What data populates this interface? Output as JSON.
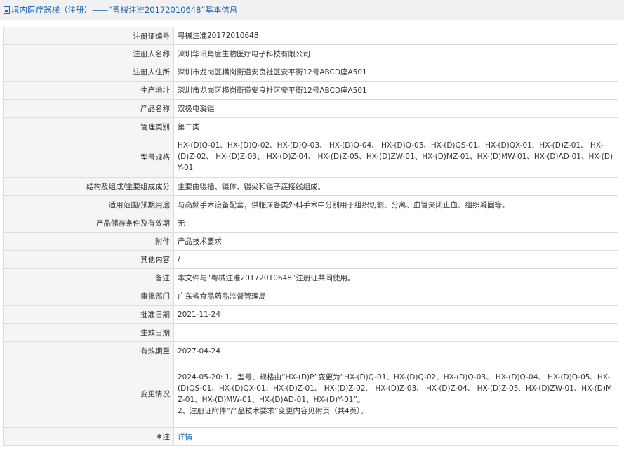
{
  "header": {
    "title": "境内医疗器械（注册）——“粤械注准20172010648”基本信息"
  },
  "rows": [
    {
      "label": "注册证编号",
      "value": "粤械注准20172010648"
    },
    {
      "label": "注册人名称",
      "value": "深圳华讯角度生物医疗电子科技有限公司"
    },
    {
      "label": "注册人住所",
      "value": "深圳市龙岗区横岗街道安良社区安平街12号ABCD座A501"
    },
    {
      "label": "生产地址",
      "value": "深圳市龙岗区横岗街道安良社区安平街12号ABCD座A501"
    },
    {
      "label": "产品名称",
      "value": "双极电凝镊"
    },
    {
      "label": "管理类别",
      "value": "第二类"
    },
    {
      "label": "型号规格",
      "value": "HX-(D)Q-01、HX-(D)Q-02、HX-(D)Q-03、 HX-(D)Q-04、 HX-(D)Q-05、HX-(D)QS-01、HX-(D)QX-01、HX-(D)Z-01、 HX-(D)Z-02、 HX-(D)Z-03、 HX-(D)Z-04、 HX-(D)Z-05、HX-(D)ZW-01、HX-(D)MZ-01、HX-(D)MW-01、HX-(D)AD-01、HX-(D)Y-01"
    },
    {
      "label": "结构及组成/主要组成成分",
      "value": "主要由镊插、镊体、镊尖和镊子连接线组成。"
    },
    {
      "label": "适用范围/预期用途",
      "value": "与高频手术设备配套，供临床各类外科手术中分别用于组织切割、分离、血管夹闭止血、组织凝固等。"
    },
    {
      "label": "产品储存条件及有效期",
      "value": "无"
    },
    {
      "label": "附件",
      "value": "产品技术要求"
    },
    {
      "label": "其他内容",
      "value": "/"
    },
    {
      "label": "备注",
      "value": "本文件与“粤械注准20172010648”注册证共同使用。"
    },
    {
      "label": "审批部门",
      "value": "广东省食品药品监督管理局"
    },
    {
      "label": "批准日期",
      "value": "2021-11-24"
    },
    {
      "label": "生效日期",
      "value": ""
    },
    {
      "label": "有效期至",
      "value": "2027-04-24"
    }
  ],
  "change": {
    "label": "变更情况",
    "line1": "2024-05-20: 1、型号、规格由“HX-(D)P”变更为“HX-(D)Q-01、HX-(D)Q-02、HX-(D)Q-03、 HX-(D)Q-04、 HX-(D)Q-05、HX-(D)QS-01、HX-(D)QX-01、HX-(D)Z-01、 HX-(D)Z-02、 HX-(D)Z-03、 HX-(D)Z-04、 HX-(D)Z-05、HX-(D)ZW-01、HX-(D)MZ-01、HX-(D)MW-01、HX-(D)AD-01、HX-(D)Y-01”。",
    "line2": "2、注册证附件“产品技术要求”变更内容见附页（共4页）。"
  },
  "note": {
    "label": "注",
    "link_text": "详情"
  }
}
